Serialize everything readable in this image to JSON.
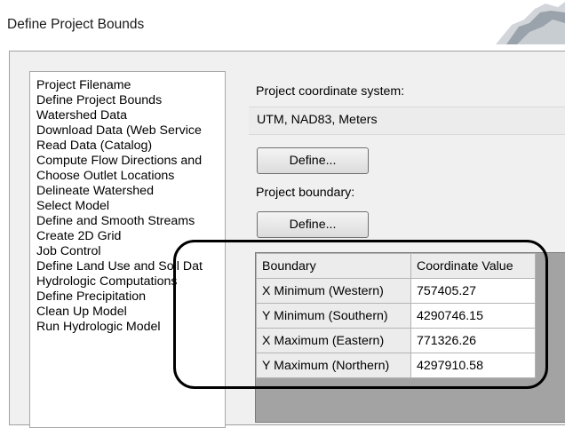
{
  "window": {
    "title": "Define Project Bounds"
  },
  "steps": [
    "Project Filename",
    "Define Project Bounds",
    "Watershed Data",
    "Download Data (Web Service",
    "Read Data (Catalog)",
    "Compute Flow Directions and",
    "Choose Outlet Locations",
    "Delineate Watershed",
    "Select Model",
    "Define and Smooth Streams",
    "Create 2D Grid",
    "Job Control",
    "Define Land Use and Soil Dat",
    "Hydrologic Computations",
    "Define Precipitation",
    "Clean Up Model",
    "Run Hydrologic Model"
  ],
  "coord_system": {
    "label": "Project coordinate system:",
    "value": "UTM, NAD83, Meters",
    "define_button": "Define..."
  },
  "boundary": {
    "label": "Project boundary:",
    "define_button": "Define...",
    "table": {
      "headers": [
        "Boundary",
        "Coordinate Value"
      ],
      "rows": [
        [
          "X Minimum (Western)",
          "757405.27"
        ],
        [
          "Y Minimum (Southern)",
          "4290746.15"
        ],
        [
          "X Maximum (Eastern)",
          "771326.26"
        ],
        [
          "Y Maximum (Northern)",
          "4297910.58"
        ]
      ]
    }
  },
  "colors": {
    "dialog_background": "#f0f0f0",
    "highlight_outline": "#000000",
    "grid_background": "#a3a3a3"
  }
}
